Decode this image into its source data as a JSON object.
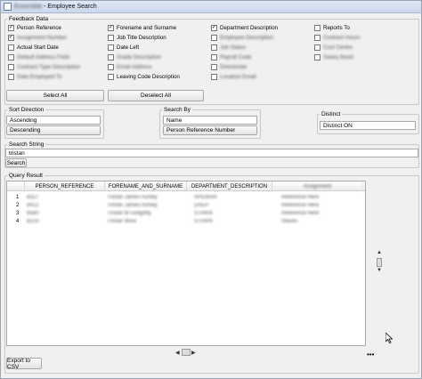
{
  "window": {
    "title_blurred": "Ensemble",
    "title": "- Employee Search"
  },
  "feedback": {
    "legend": "Feedback Data",
    "checkboxes": [
      {
        "label": "Person Reference",
        "checked": true,
        "blurred": false
      },
      {
        "label": "Assignment Number",
        "checked": true,
        "blurred": true
      },
      {
        "label": "Actual Start Date",
        "checked": false,
        "blurred": false
      },
      {
        "label": "Default Address Field",
        "checked": false,
        "blurred": true
      },
      {
        "label": "Contract Type Description",
        "checked": false,
        "blurred": true
      },
      {
        "label": "Date Employed To",
        "checked": false,
        "blurred": true
      },
      {
        "label": "Forename and Surname",
        "checked": true,
        "blurred": false
      },
      {
        "label": "Job Title Description",
        "checked": false,
        "blurred": false
      },
      {
        "label": "Date Left",
        "checked": false,
        "blurred": false
      },
      {
        "label": "Grade Description",
        "checked": false,
        "blurred": true
      },
      {
        "label": "Email Address",
        "checked": false,
        "blurred": true
      },
      {
        "label": "Leaving Code Description",
        "checked": false,
        "blurred": false
      },
      {
        "label": "Department Description",
        "checked": true,
        "blurred": false
      },
      {
        "label": "Employee Description",
        "checked": false,
        "blurred": true
      },
      {
        "label": "Job Status",
        "checked": false,
        "blurred": true
      },
      {
        "label": "Payroll Code",
        "checked": false,
        "blurred": true
      },
      {
        "label": "Directorate",
        "checked": false,
        "blurred": true
      },
      {
        "label": "Location Email",
        "checked": false,
        "blurred": true
      },
      {
        "label": "Reports To",
        "checked": false,
        "blurred": false
      },
      {
        "label": "Contract Hours",
        "checked": false,
        "blurred": true
      },
      {
        "label": "Cost Centre",
        "checked": false,
        "blurred": true
      },
      {
        "label": "Salary Band",
        "checked": false,
        "blurred": true
      }
    ],
    "select_all": "Select All",
    "deselect_all": "Deselect All"
  },
  "sort": {
    "legend": "Sort Direction",
    "options": [
      "Ascending",
      "Descending"
    ]
  },
  "search_by": {
    "legend": "Search By",
    "options": [
      "Name",
      "Person Reference Number"
    ]
  },
  "distinct": {
    "legend": "Distinct",
    "value": "Distinct ON"
  },
  "search_string": {
    "legend": "Search String",
    "value": "tristan",
    "button": "Search"
  },
  "query": {
    "legend": "Query Result",
    "columns": [
      "PERSON_REFERENCE",
      "FORENAME_AND_SURNAME",
      "DEPARTMENT_DESCRIPTION",
      "Assignment"
    ],
    "rows": [
      {
        "idx": "1",
        "cells": [
          "8327",
          "Tristan James Ashley",
          "SPEWAR",
          "Reference Here"
        ]
      },
      {
        "idx": "2",
        "cells": [
          "8412",
          "Tristan James Ashley",
          "DAEP",
          "Reference Here"
        ]
      },
      {
        "idx": "3",
        "cells": [
          "9580",
          "Tristan M Golightly",
          "STHRN",
          "Reference Here"
        ]
      },
      {
        "idx": "4",
        "cells": [
          "8219",
          "Tristan Wise",
          "STHRN",
          "Staves"
        ]
      }
    ]
  },
  "export_button": "Export to CSV"
}
